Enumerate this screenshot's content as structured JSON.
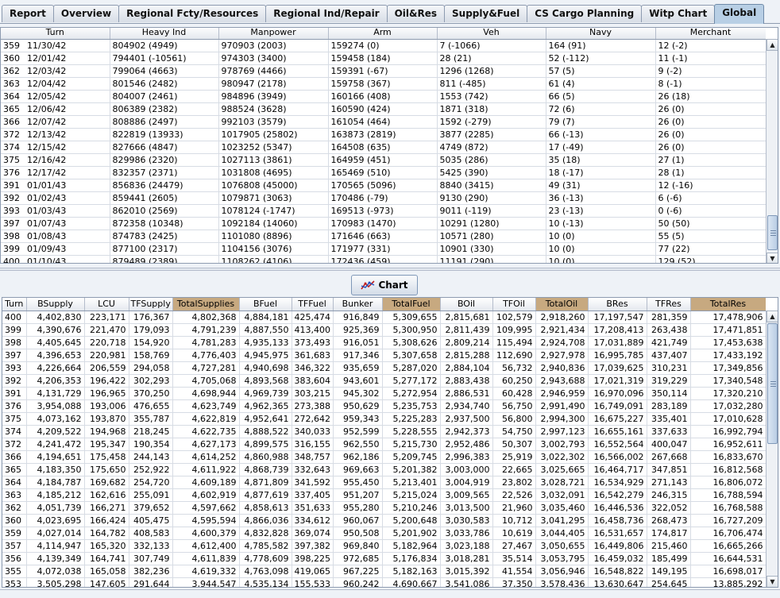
{
  "tabs": [
    "Report",
    "Overview",
    "Regional Fcty/Resources",
    "Regional Ind/Repair",
    "Oil&Res",
    "Supply&Fuel",
    "CS Cargo Planning",
    "Witp Chart",
    "Global"
  ],
  "active_tab": "Global",
  "top_table": {
    "columns": [
      "Turn",
      "Heavy Ind",
      "Manpower",
      "Arm",
      "Veh",
      "Navy",
      "Merchant"
    ],
    "partial_row": [
      "359",
      "11/30/42",
      "804902  (4949)",
      "970903  (2003)",
      "159274  (0)",
      "7   (-1066)",
      "164  (91)",
      "12  (-2)"
    ],
    "rows": [
      [
        "360",
        "12/01/42",
        "794401  (-10561)",
        "974303  (3400)",
        "159458  (184)",
        "28  (21)",
        "52  (-112)",
        "11  (-1)"
      ],
      [
        "362",
        "12/03/42",
        "799064  (4663)",
        "978769  (4466)",
        "159391  (-67)",
        "1296  (1268)",
        "57  (5)",
        "9  (-2)"
      ],
      [
        "363",
        "12/04/42",
        "801546  (2482)",
        "980947  (2178)",
        "159758  (367)",
        "811  (-485)",
        "61  (4)",
        "8  (-1)"
      ],
      [
        "364",
        "12/05/42",
        "804007  (2461)",
        "984896  (3949)",
        "160166  (408)",
        "1553  (742)",
        "66  (5)",
        "26  (18)"
      ],
      [
        "365",
        "12/06/42",
        "806389  (2382)",
        "988524  (3628)",
        "160590  (424)",
        "1871  (318)",
        "72  (6)",
        "26  (0)"
      ],
      [
        "366",
        "12/07/42",
        "808886  (2497)",
        "992103  (3579)",
        "161054  (464)",
        "1592  (-279)",
        "79  (7)",
        "26  (0)"
      ],
      [
        "372",
        "12/13/42",
        "822819  (13933)",
        "1017905  (25802)",
        "163873  (2819)",
        "3877  (2285)",
        "66  (-13)",
        "26  (0)"
      ],
      [
        "374",
        "12/15/42",
        "827666  (4847)",
        "1023252  (5347)",
        "164508  (635)",
        "4749  (872)",
        "17  (-49)",
        "26  (0)"
      ],
      [
        "375",
        "12/16/42",
        "829986  (2320)",
        "1027113  (3861)",
        "164959  (451)",
        "5035  (286)",
        "35  (18)",
        "27  (1)"
      ],
      [
        "376",
        "12/17/42",
        "832357  (2371)",
        "1031808  (4695)",
        "165469  (510)",
        "5425  (390)",
        "18  (-17)",
        "28  (1)"
      ],
      [
        "391",
        "01/01/43",
        "856836  (24479)",
        "1076808  (45000)",
        "170565  (5096)",
        "8840  (3415)",
        "49  (31)",
        "12  (-16)"
      ],
      [
        "392",
        "01/02/43",
        "859441  (2605)",
        "1079871  (3063)",
        "170486  (-79)",
        "9130  (290)",
        "36  (-13)",
        "6  (-6)"
      ],
      [
        "393",
        "01/03/43",
        "862010  (2569)",
        "1078124  (-1747)",
        "169513  (-973)",
        "9011  (-119)",
        "23  (-13)",
        "0  (-6)"
      ],
      [
        "397",
        "01/07/43",
        "872358  (10348)",
        "1092184  (14060)",
        "170983  (1470)",
        "10291  (1280)",
        "10  (-13)",
        "50  (50)"
      ],
      [
        "398",
        "01/08/43",
        "874783  (2425)",
        "1101080  (8896)",
        "171646  (663)",
        "10571  (280)",
        "10  (0)",
        "55  (5)"
      ],
      [
        "399",
        "01/09/43",
        "877100  (2317)",
        "1104156  (3076)",
        "171977  (331)",
        "10901  (330)",
        "10  (0)",
        "77  (22)"
      ],
      [
        "400",
        "01/10/43",
        "879489  (2389)",
        "1108262  (4106)",
        "172436  (459)",
        "11191  (290)",
        "10  (0)",
        "129  (52)"
      ]
    ]
  },
  "chart_button": {
    "label": "Chart",
    "icon": "line-chart-icon"
  },
  "bottom_table": {
    "columns": [
      "Turn",
      "BSupply",
      "LCU",
      "TFSupply",
      "TotalSupplies",
      "BFuel",
      "TFFuel",
      "Bunker",
      "TotalFuel",
      "BOil",
      "TFOil",
      "TotalOil",
      "BRes",
      "TFRes",
      "TotalRes"
    ],
    "highlight_columns": [
      "TotalSupplies",
      "TotalFuel",
      "TotalOil",
      "TotalRes"
    ],
    "rows": [
      [
        "400",
        "4,402,830",
        "223,171",
        "176,367",
        "4,802,368",
        "4,884,181",
        "425,474",
        "916,849",
        "5,309,655",
        "2,815,681",
        "102,579",
        "2,918,260",
        "17,197,547",
        "281,359",
        "17,478,906"
      ],
      [
        "399",
        "4,390,676",
        "221,470",
        "179,093",
        "4,791,239",
        "4,887,550",
        "413,400",
        "925,369",
        "5,300,950",
        "2,811,439",
        "109,995",
        "2,921,434",
        "17,208,413",
        "263,438",
        "17,471,851"
      ],
      [
        "398",
        "4,405,645",
        "220,718",
        "154,920",
        "4,781,283",
        "4,935,133",
        "373,493",
        "916,051",
        "5,308,626",
        "2,809,214",
        "115,494",
        "2,924,708",
        "17,031,889",
        "421,749",
        "17,453,638"
      ],
      [
        "397",
        "4,396,653",
        "220,981",
        "158,769",
        "4,776,403",
        "4,945,975",
        "361,683",
        "917,346",
        "5,307,658",
        "2,815,288",
        "112,690",
        "2,927,978",
        "16,995,785",
        "437,407",
        "17,433,192"
      ],
      [
        "393",
        "4,226,664",
        "206,559",
        "294,058",
        "4,727,281",
        "4,940,698",
        "346,322",
        "935,659",
        "5,287,020",
        "2,884,104",
        "56,732",
        "2,940,836",
        "17,039,625",
        "310,231",
        "17,349,856"
      ],
      [
        "392",
        "4,206,353",
        "196,422",
        "302,293",
        "4,705,068",
        "4,893,568",
        "383,604",
        "943,601",
        "5,277,172",
        "2,883,438",
        "60,250",
        "2,943,688",
        "17,021,319",
        "319,229",
        "17,340,548"
      ],
      [
        "391",
        "4,131,729",
        "196,965",
        "370,250",
        "4,698,944",
        "4,969,739",
        "303,215",
        "945,302",
        "5,272,954",
        "2,886,531",
        "60,428",
        "2,946,959",
        "16,970,096",
        "350,114",
        "17,320,210"
      ],
      [
        "376",
        "3,954,088",
        "193,006",
        "476,655",
        "4,623,749",
        "4,962,365",
        "273,388",
        "950,629",
        "5,235,753",
        "2,934,740",
        "56,750",
        "2,991,490",
        "16,749,091",
        "283,189",
        "17,032,280"
      ],
      [
        "375",
        "4,073,162",
        "193,870",
        "355,787",
        "4,622,819",
        "4,952,641",
        "272,642",
        "959,343",
        "5,225,283",
        "2,937,500",
        "56,800",
        "2,994,300",
        "16,675,227",
        "335,401",
        "17,010,628"
      ],
      [
        "374",
        "4,209,522",
        "194,968",
        "218,245",
        "4,622,735",
        "4,888,522",
        "340,033",
        "952,599",
        "5,228,555",
        "2,942,373",
        "54,750",
        "2,997,123",
        "16,655,161",
        "337,633",
        "16,992,794"
      ],
      [
        "372",
        "4,241,472",
        "195,347",
        "190,354",
        "4,627,173",
        "4,899,575",
        "316,155",
        "962,550",
        "5,215,730",
        "2,952,486",
        "50,307",
        "3,002,793",
        "16,552,564",
        "400,047",
        "16,952,611"
      ],
      [
        "366",
        "4,194,651",
        "175,458",
        "244,143",
        "4,614,252",
        "4,860,988",
        "348,757",
        "962,186",
        "5,209,745",
        "2,996,383",
        "25,919",
        "3,022,302",
        "16,566,002",
        "267,668",
        "16,833,670"
      ],
      [
        "365",
        "4,183,350",
        "175,650",
        "252,922",
        "4,611,922",
        "4,868,739",
        "332,643",
        "969,663",
        "5,201,382",
        "3,003,000",
        "22,665",
        "3,025,665",
        "16,464,717",
        "347,851",
        "16,812,568"
      ],
      [
        "364",
        "4,184,787",
        "169,682",
        "254,720",
        "4,609,189",
        "4,871,809",
        "341,592",
        "955,450",
        "5,213,401",
        "3,004,919",
        "23,802",
        "3,028,721",
        "16,534,929",
        "271,143",
        "16,806,072"
      ],
      [
        "363",
        "4,185,212",
        "162,616",
        "255,091",
        "4,602,919",
        "4,877,619",
        "337,405",
        "951,207",
        "5,215,024",
        "3,009,565",
        "22,526",
        "3,032,091",
        "16,542,279",
        "246,315",
        "16,788,594"
      ],
      [
        "362",
        "4,051,739",
        "166,271",
        "379,652",
        "4,597,662",
        "4,858,613",
        "351,633",
        "955,280",
        "5,210,246",
        "3,013,500",
        "21,960",
        "3,035,460",
        "16,446,536",
        "322,052",
        "16,768,588"
      ],
      [
        "360",
        "4,023,695",
        "166,424",
        "405,475",
        "4,595,594",
        "4,866,036",
        "334,612",
        "960,067",
        "5,200,648",
        "3,030,583",
        "10,712",
        "3,041,295",
        "16,458,736",
        "268,473",
        "16,727,209"
      ],
      [
        "359",
        "4,027,014",
        "164,782",
        "408,583",
        "4,600,379",
        "4,832,828",
        "369,074",
        "950,508",
        "5,201,902",
        "3,033,786",
        "10,619",
        "3,044,405",
        "16,531,657",
        "174,817",
        "16,706,474"
      ],
      [
        "357",
        "4,114,947",
        "165,320",
        "332,133",
        "4,612,400",
        "4,785,582",
        "397,382",
        "969,840",
        "5,182,964",
        "3,023,188",
        "27,467",
        "3,050,655",
        "16,449,806",
        "215,460",
        "16,665,266"
      ],
      [
        "356",
        "4,139,349",
        "164,741",
        "307,749",
        "4,611,839",
        "4,778,609",
        "398,225",
        "972,685",
        "5,176,834",
        "3,018,281",
        "35,514",
        "3,053,795",
        "16,459,032",
        "185,499",
        "16,644,531"
      ],
      [
        "355",
        "4,072,038",
        "165,058",
        "382,236",
        "4,619,332",
        "4,763,098",
        "419,065",
        "967,225",
        "5,182,163",
        "3,015,392",
        "41,554",
        "3,056,946",
        "16,548,822",
        "149,195",
        "16,698,017"
      ]
    ],
    "partial_row": [
      "353",
      "3,505,298",
      "147,605",
      "291,644",
      "3,944,547",
      "4,535,134",
      "155,533",
      "960,242",
      "4,690,667",
      "3,541,086",
      "37,350",
      "3,578,436",
      "13,630,647",
      "254,645",
      "13,885,292"
    ]
  }
}
